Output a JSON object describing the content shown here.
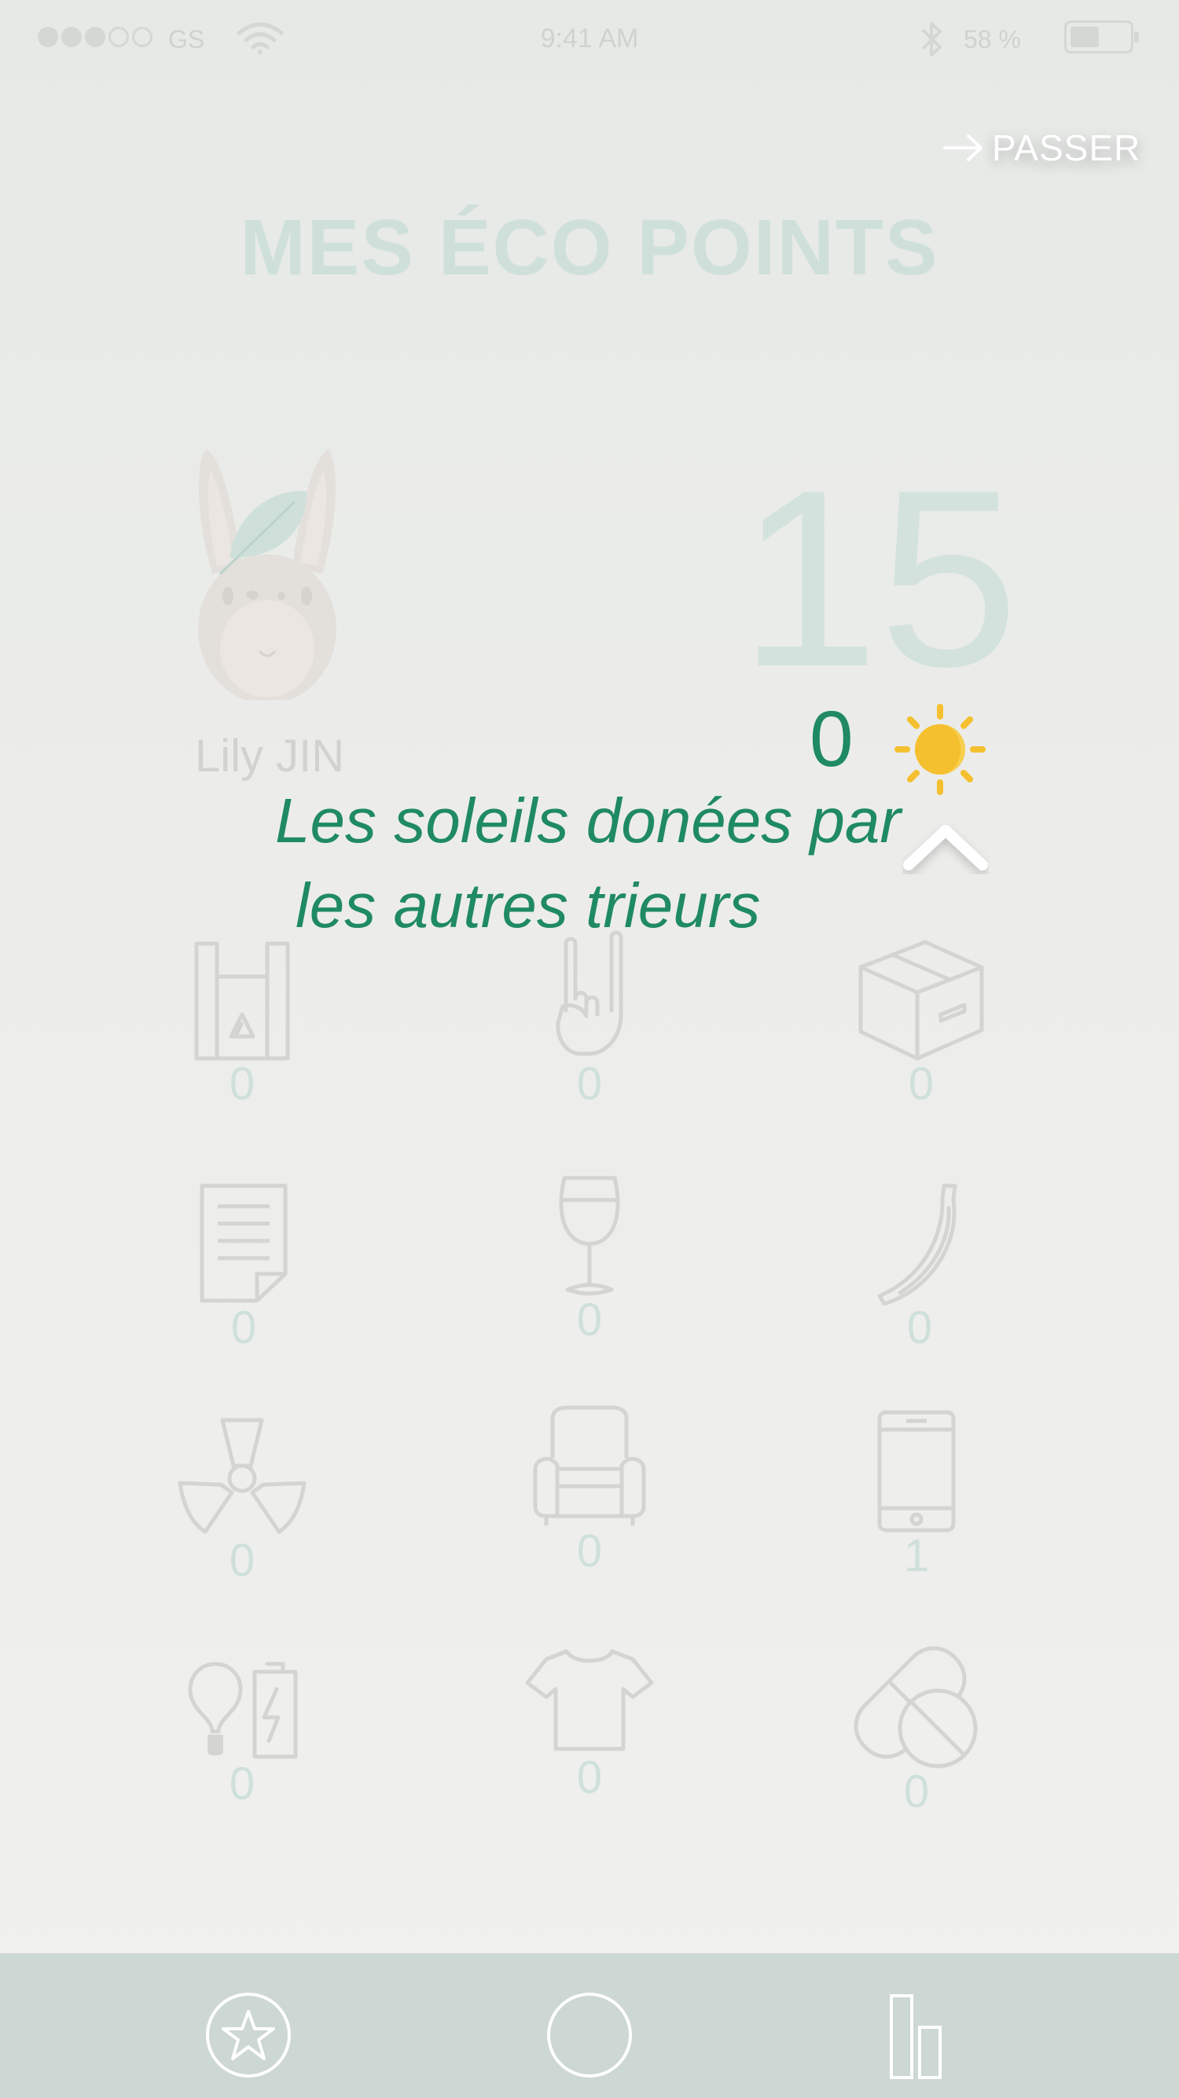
{
  "status_bar": {
    "carrier": "GS",
    "time": "9:41 AM",
    "battery": "58 %"
  },
  "header": {
    "skip_label": "PASSER",
    "title": "MES ÉCO POINTS"
  },
  "profile": {
    "name": "Lily JIN",
    "points": "15",
    "suns": "0"
  },
  "tooltip": {
    "line1": "Les soleils donées par",
    "line2": "les autres trieurs"
  },
  "categories": [
    {
      "icon": "plastic-bag-icon",
      "count": "0"
    },
    {
      "icon": "rock-hand-icon",
      "count": "0"
    },
    {
      "icon": "cardboard-box-icon",
      "count": "0"
    },
    {
      "icon": "paper-document-icon",
      "count": "0"
    },
    {
      "icon": "wine-glass-icon",
      "count": "0"
    },
    {
      "icon": "banana-icon",
      "count": "0"
    },
    {
      "icon": "radioactive-icon",
      "count": "0"
    },
    {
      "icon": "armchair-icon",
      "count": "0"
    },
    {
      "icon": "smartphone-icon",
      "count": "1"
    },
    {
      "icon": "bulb-battery-icon",
      "count": "0"
    },
    {
      "icon": "tshirt-icon",
      "count": "0"
    },
    {
      "icon": "pills-icon",
      "count": "0"
    }
  ],
  "tab_bar": [
    {
      "icon": "star-circle-icon"
    },
    {
      "icon": "circle-icon"
    },
    {
      "icon": "bar-chart-icon"
    }
  ],
  "colors": {
    "accent": "#1f8a64",
    "faded_mint": "#cfe0da",
    "sun": "#f5c02f",
    "tab_bar": "#cdd7d3"
  }
}
